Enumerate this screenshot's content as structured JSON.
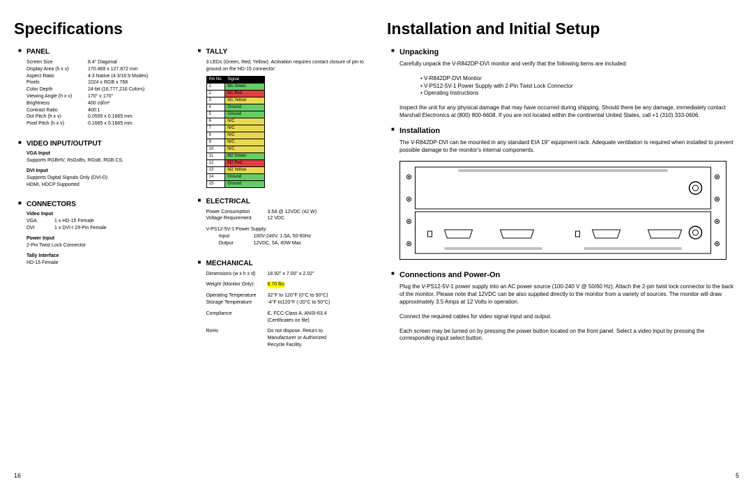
{
  "left": {
    "title": "Specifications",
    "pagenum": "16",
    "panel": {
      "head": "PANEL",
      "rows": [
        [
          "Screen Size",
          "8.4\" Diagonal"
        ],
        [
          "Display Area (h x v)",
          "170.469 x 127.872 mm"
        ],
        [
          "Aspect Ratio",
          "4:3 Native (4:3/16:9 Modes)"
        ],
        [
          "Pixels",
          "1024 x RGB x 768"
        ],
        [
          "Color Depth",
          "24-bit (16,777,216 Colors)"
        ],
        [
          "Viewing Angle (h x v)",
          "170° x 170°"
        ],
        [
          "Brightness",
          "400 cd/m²"
        ],
        [
          "Contrast Ratio",
          "400:1"
        ],
        [
          "Dot Pitch (h x v)",
          "0.0555 x 0.1665 mm"
        ],
        [
          "Pixel Pitch (h x v)",
          "0.1665 x 0.1665 mm"
        ]
      ]
    },
    "video": {
      "head": "VIDEO INPUT/OUTPUT",
      "vga_head": "VGA Input",
      "vga_text": "Supports RGBHV, RsGsBs, RGsB, RGB CS,",
      "dvi_head": "DVI Input",
      "dvi_text": "Supports Digital Signals Only (DVI-D)\nHDMI, HDCP Supported"
    },
    "connectors": {
      "head": "CONNECTORS",
      "vi_head": "Video Input",
      "vi_rows": [
        [
          "VGA",
          "1 x HD-15 Female"
        ],
        [
          "DVI",
          "1 x DVI-I 29-Pin Female"
        ]
      ],
      "pi_head": "Power Input",
      "pi_text": "2-Pin Twist Lock Connector",
      "ti_head": "Tally Interface",
      "ti_text": "HD-15 Female"
    },
    "tally": {
      "head": "TALLY",
      "desc": "3 LEDs (Green, Red, Yellow). Activation requires contact closure of pin to ground on the HD-15 connector:",
      "th1": "Pin No.",
      "th2": "Signal",
      "pins": [
        [
          "1",
          "M1 Green",
          "grn"
        ],
        [
          "2",
          "M1 Red",
          "red"
        ],
        [
          "3",
          "M1 Yellow",
          "yel"
        ],
        [
          "4",
          "Ground",
          "gnd"
        ],
        [
          "5",
          "Ground",
          "gnd"
        ],
        [
          "6",
          "N/C",
          "nc"
        ],
        [
          "7",
          "N/C",
          "nc"
        ],
        [
          "8",
          "N/C",
          "nc"
        ],
        [
          "9",
          "N/C",
          "nc"
        ],
        [
          "10",
          "N/C",
          "nc"
        ],
        [
          "11",
          "M2 Green",
          "grn"
        ],
        [
          "12",
          "M2 Red",
          "red"
        ],
        [
          "13",
          "M2 Yellow",
          "yel"
        ],
        [
          "14",
          "Ground",
          "gnd"
        ],
        [
          "15",
          "Ground",
          "gnd"
        ]
      ]
    },
    "electrical": {
      "head": "ELECTRICAL",
      "rows": [
        [
          "Power Consumption",
          "3.5A @ 12VDC (42 W)"
        ],
        [
          "Voltage Requirement",
          "12 VDC"
        ]
      ],
      "ps_head": "V-PS12-5V-1 Power Supply:",
      "ps_rows": [
        [
          "Input",
          "100V-240V, 1.5A, 50-60Hz"
        ],
        [
          "Output",
          "12VDC, 5A, 60W Max"
        ]
      ]
    },
    "mechanical": {
      "head": "MECHANICAL",
      "dim_lbl": "Dimensions (w x h x d)",
      "dim_val": "18.92\" x 7.00\" x 2.02\"",
      "weight_lbl": "Weight (Monitor Only):",
      "weight_val": "6.70 lbs",
      "rows": [
        [
          "Operating Temperature",
          "32°F to 120°F (0°C to 50°C)"
        ],
        [
          "Storage Temperature",
          "-4°F to120°F (-20°C to 50°C)"
        ]
      ],
      "comp_lbl": "Compliance",
      "comp_val": "Є, FCC-Class A, ANSI-63.4\n(Certificates on file)",
      "rohs_lbl": "RoHs",
      "rohs_val": "Do not dispose. Return to\nManufacturer or Authorized\nRecycle Facility."
    }
  },
  "right": {
    "title": "Installation and Initial Setup",
    "pagenum": "5",
    "unpacking": {
      "head": "Unpacking",
      "p1": "Carefully unpack the V-R842DP-DVI monitor and verify that the following items are included:",
      "items": [
        "V-R842DP-DVI Monitor",
        "V-PS12-5V-1 Power Supply with 2-Pin Twist Lock Connector",
        "Operating Instructions"
      ],
      "p2": "Inspect the unit for any physical damage that may have occurred during shipping. Should there be any damage, immediately contact Marshall Electronics at (800) 800-6608. If you are not located within the continental United States, call +1 (310) 333-0606."
    },
    "installation": {
      "head": "Installation",
      "p1": "The V-R842DP-DVI can be mounted in any standard EIA 19\" equipment rack. Adequate ventilation is required when installed to prevent possible damage to the monitor's internal components."
    },
    "connections": {
      "head": "Connections and Power-On",
      "p1": "Plug the V-PS12-5V-1 power supply into an AC power source (100-240 V @ 50/60 Hz). Attach the 2-pin twist lock connector to the back of the monitor. Please note that 12VDC can be also supplied directly to the monitor from a variety of sources. The monitor will draw approximately 3.5 Amps at 12 Volts in operation.",
      "p2": "Connect the required cables for video signal input and output.",
      "p3": "Each screen may be turned on by pressing the power button located on the front panel. Select a video input by pressing the corresponding input select button."
    }
  }
}
